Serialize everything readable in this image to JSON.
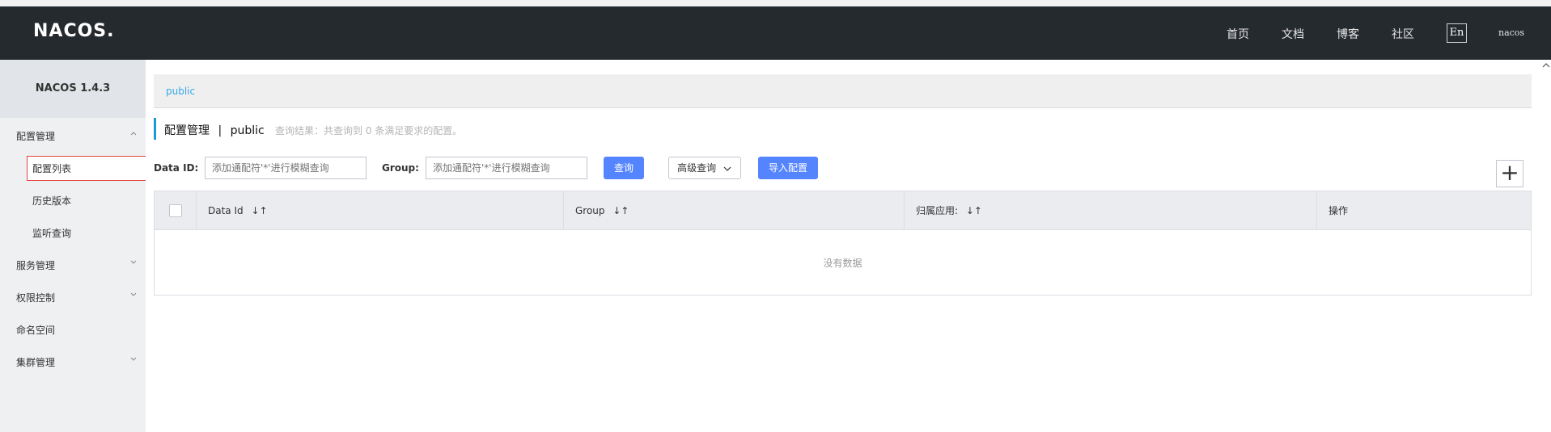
{
  "header": {
    "logo": "NACOS.",
    "nav": [
      "首页",
      "文档",
      "博客",
      "社区"
    ],
    "lang_button": "En",
    "user": "nacos"
  },
  "sidebar": {
    "version": "NACOS 1.4.3",
    "menu": {
      "config_management": "配置管理",
      "config_list": "配置列表",
      "history_version": "历史版本",
      "listen_query": "监听查询",
      "service_management": "服务管理",
      "permission_control": "权限控制",
      "namespace": "命名空间",
      "cluster_management": "集群管理"
    }
  },
  "main": {
    "namespace_link": "public",
    "title_prefix": "配置管理",
    "title_sep": "|",
    "title_ns": "public",
    "query_result": "查询结果：共查询到 0 条满足要求的配置。"
  },
  "search": {
    "data_id_label": "Data ID:",
    "data_id_placeholder": "添加通配符'*'进行模糊查询",
    "group_label": "Group:",
    "group_placeholder": "添加通配符'*'进行模糊查询",
    "query_button": "查询",
    "advanced_button": "高级查询",
    "import_button": "导入配置",
    "add_button": "+"
  },
  "table": {
    "columns": [
      "Data Id",
      "Group",
      "归属应用:",
      "操作"
    ],
    "empty_text": "没有数据"
  },
  "colors": {
    "header_bg": "#252a2f",
    "primary": "#5584ff",
    "link": "#33a9e8",
    "active_border": "#e64340"
  }
}
